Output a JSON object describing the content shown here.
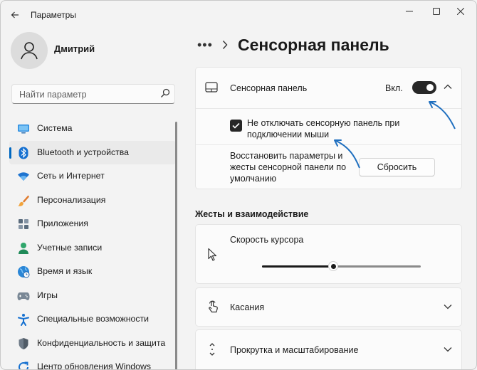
{
  "window": {
    "title": "Параметры"
  },
  "user": {
    "name": "Дмитрий"
  },
  "search": {
    "placeholder": "Найти параметр"
  },
  "sidebar": {
    "items": [
      {
        "label": "Система",
        "icon": "monitor-icon"
      },
      {
        "label": "Bluetooth и устройства",
        "icon": "bluetooth-icon",
        "active": true
      },
      {
        "label": "Сеть и Интернет",
        "icon": "wifi-icon"
      },
      {
        "label": "Персонализация",
        "icon": "brush-icon"
      },
      {
        "label": "Приложения",
        "icon": "apps-icon"
      },
      {
        "label": "Учетные записи",
        "icon": "account-icon"
      },
      {
        "label": "Время и язык",
        "icon": "globe-clock-icon"
      },
      {
        "label": "Игры",
        "icon": "gamepad-icon"
      },
      {
        "label": "Специальные возможности",
        "icon": "accessibility-icon"
      },
      {
        "label": "Конфиденциальность и защита",
        "icon": "shield-icon"
      },
      {
        "label": "Центр обновления Windows",
        "icon": "update-icon"
      }
    ]
  },
  "breadcrumb": {
    "dots": "•••",
    "title": "Сенсорная панель"
  },
  "touchpad": {
    "label": "Сенсорная панель",
    "state_label": "Вкл.",
    "enabled": true,
    "checkbox_label_line1": "Не отключать сенсорную панель при",
    "checkbox_label_line2": "подключении мыши",
    "checkbox_checked": true,
    "reset_text_line1": "Восстановить параметры и",
    "reset_text_line2": "жесты сенсорной панели по",
    "reset_text_line3": "умолчанию",
    "reset_button": "Сбросить"
  },
  "gestures": {
    "section_title": "Жесты и взаимодействие",
    "cursor_speed_label": "Скорость курсора",
    "cursor_speed_value": 0.45,
    "taps_label": "Касания",
    "scroll_zoom_label": "Прокрутка и масштабирование"
  },
  "colors": {
    "accent": "#0067c0",
    "toggle_on": "#272727",
    "annotation_arrow": "#1f6fbf"
  }
}
